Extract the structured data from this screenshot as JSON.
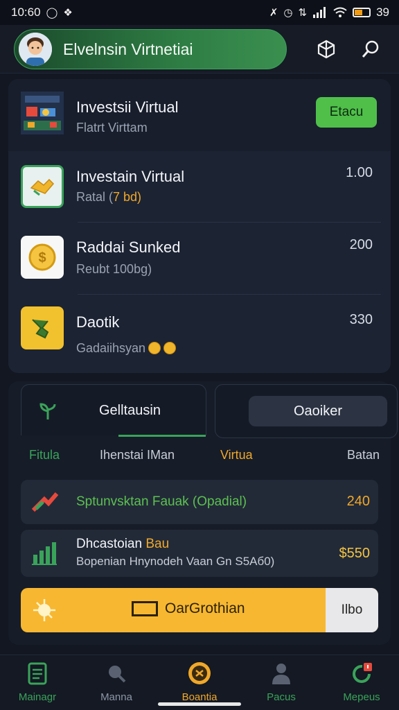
{
  "status_bar": {
    "time": "10:60",
    "battery_text": "39"
  },
  "header": {
    "profile_name": "Elvelnsin Virtnetiai"
  },
  "investments": {
    "rows": [
      {
        "title": "Investsii Virtual",
        "subtitle": "Flatrt Virttam",
        "button": "Etacu"
      },
      {
        "title": "Investain Virtual",
        "subtitle_prefix": "Ratal (",
        "subtitle_accent": "7 bd)",
        "value": "1.00"
      },
      {
        "title": "Raddai Sunked",
        "subtitle": "Reubt 100bg)",
        "value": "200"
      },
      {
        "title": "Daotik",
        "subtitle": "Gadaiihsyan",
        "coin_text": "$ D",
        "value": "330"
      }
    ]
  },
  "panel": {
    "tab_left": "Gelltausin",
    "tab_right": "Oaoiker",
    "columns": [
      "Fitula",
      "Ihenstai IMan",
      "Virtua",
      "Batan"
    ],
    "items": [
      {
        "title": "Sptunvsktan Fauak (Opadial)",
        "value": "240"
      },
      {
        "title_a": "Dhcastoian",
        "title_b": "Bau",
        "subtitle": "Bopenian Hnynodeh  Vaan Gn S5Аб0)",
        "value": "$550"
      }
    ],
    "action": {
      "label": "OarGrothian",
      "side": "Ilbo"
    }
  },
  "bottom_nav": [
    {
      "label": "Mainagr",
      "color": "#3aa35a"
    },
    {
      "label": "Manna",
      "color": "#8d96a6"
    },
    {
      "label": "Boantia",
      "color": "#f0a82a"
    },
    {
      "label": "Pacus",
      "color": "#3aa35a"
    },
    {
      "label": "Mepeus",
      "color": "#3aa35a"
    }
  ],
  "colors": {
    "accent_green": "#3aa35a",
    "accent_orange": "#f0a82a",
    "background": "#121722"
  }
}
